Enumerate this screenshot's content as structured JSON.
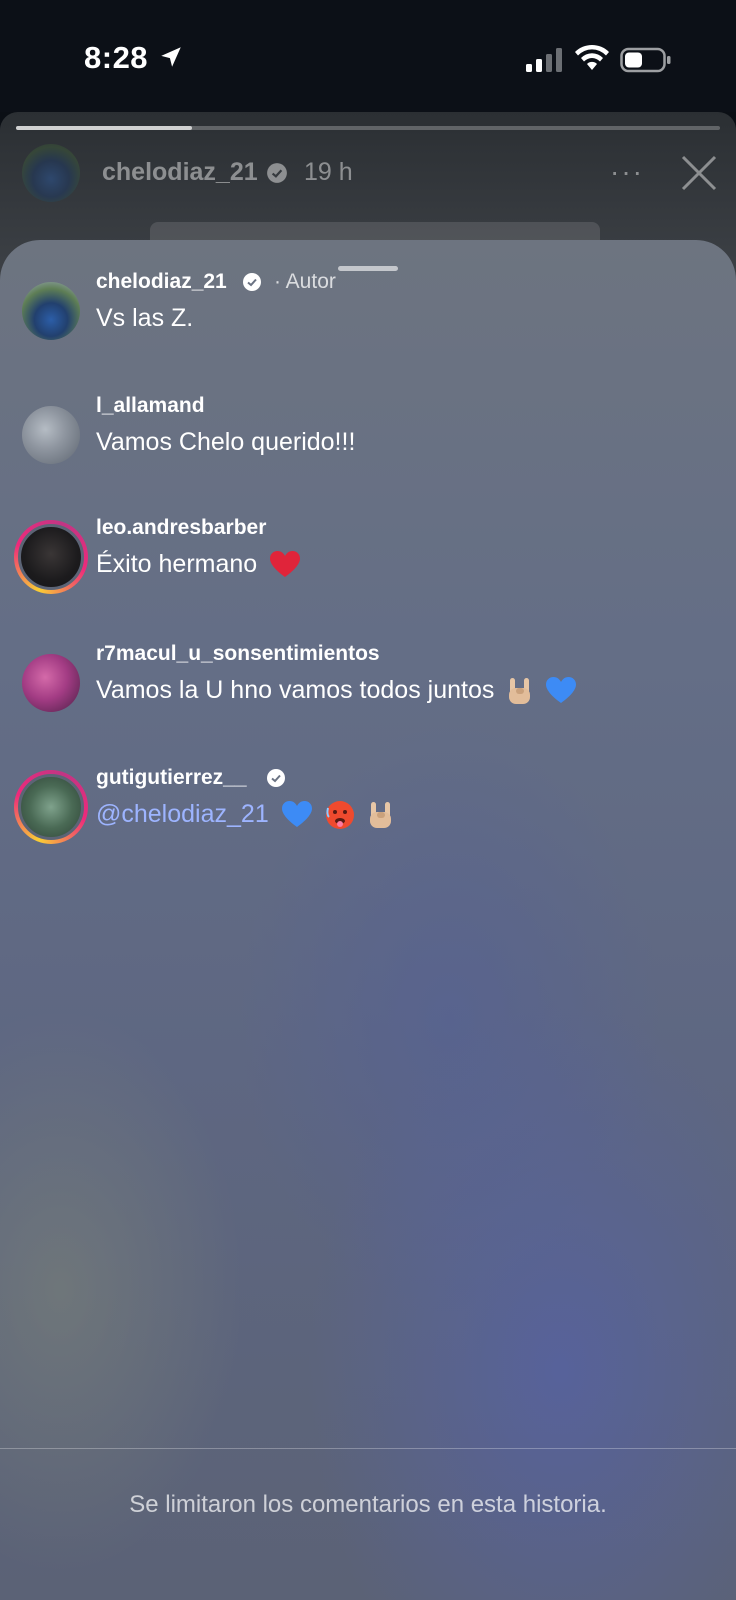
{
  "status_bar": {
    "time": "8:28"
  },
  "story": {
    "username": "chelodiaz_21",
    "time": "19 h",
    "more_label": "···",
    "progress": 0.25
  },
  "comments": [
    {
      "username": "chelodiaz_21",
      "verified": true,
      "tag": "· Autor",
      "text": "Vs las Z."
    },
    {
      "username": "l_allamand",
      "verified": false,
      "text": "Vamos Chelo querido!!!"
    },
    {
      "username": "leo.andresbarber",
      "verified": false,
      "text": "Éxito hermano"
    },
    {
      "username": "r7macul_u_sonsentimientos",
      "verified": false,
      "text": "Vamos la U hno vamos todos juntos"
    },
    {
      "username": "gutigutierrez__",
      "verified": true,
      "mention": "@chelodiaz_21"
    }
  ],
  "footer": {
    "text": "Se limitaron los comentarios en esta historia."
  },
  "colors": {
    "mention": "#9db4ff",
    "heart_red": "#e0243a",
    "heart_blue": "#3d8bf5"
  }
}
